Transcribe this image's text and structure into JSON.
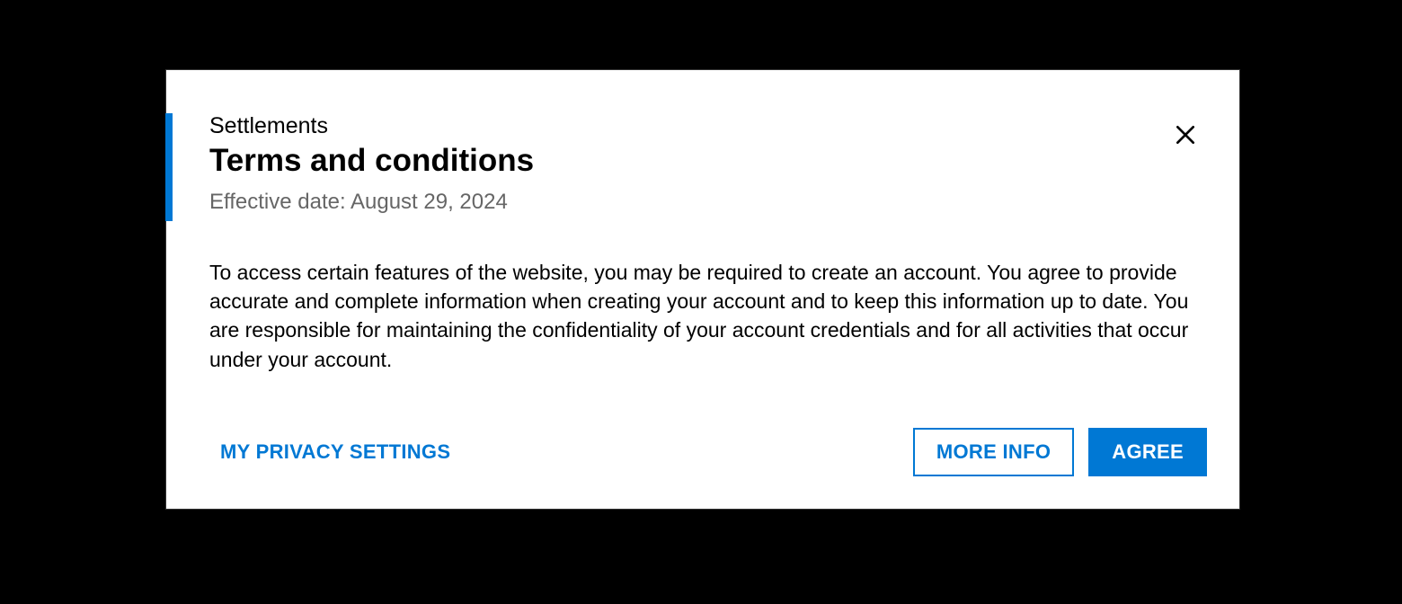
{
  "dialog": {
    "category": "Settlements",
    "title": "Terms and conditions",
    "effective_date": "Effective date: August 29, 2024",
    "body": "To access certain features of the website, you may be required to create an account. You agree to provide accurate and complete information when creating your account and to keep this information up to date. You are responsible for maintaining the confidentiality of your account credentials and for all activities that occur under your account.",
    "buttons": {
      "privacy": "MY PRIVACY SETTINGS",
      "more_info": "MORE INFO",
      "agree": "AGREE"
    }
  },
  "colors": {
    "accent": "#0078d4"
  }
}
